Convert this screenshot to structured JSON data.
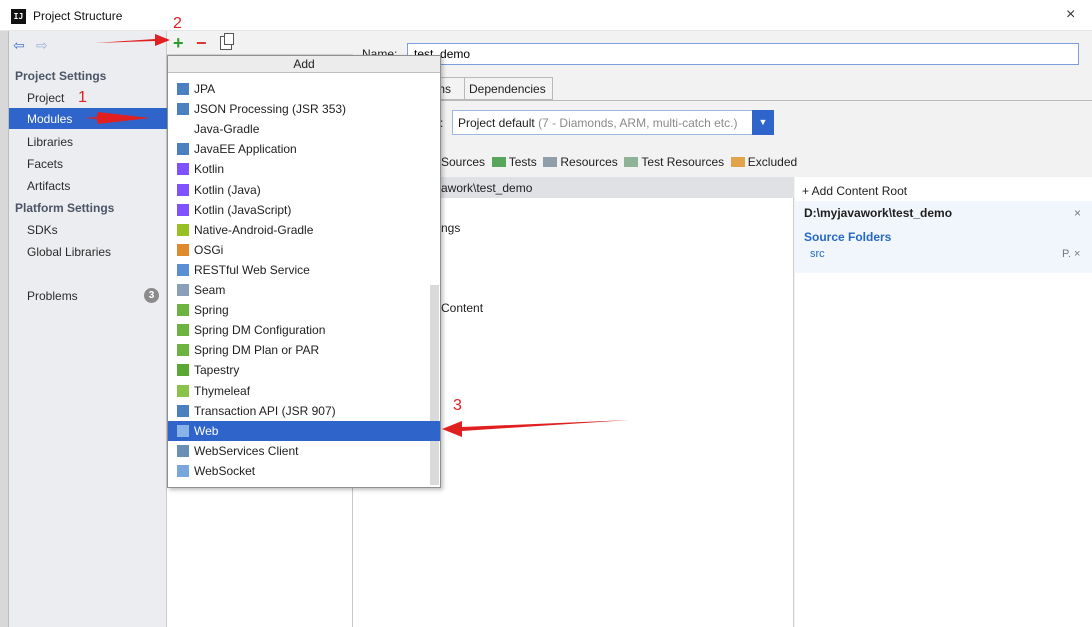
{
  "window": {
    "title": "Project Structure",
    "close": "×"
  },
  "nav": {
    "back": "⇦",
    "forward": "⇨"
  },
  "sidebar": {
    "project_settings": "Project Settings",
    "items": [
      "Project",
      "Modules",
      "Libraries",
      "Facets",
      "Artifacts"
    ],
    "platform_settings": "Platform Settings",
    "platform_items": [
      "SDKs",
      "Global Libraries"
    ],
    "problems": "Problems",
    "problems_count": "3"
  },
  "toolbar": {
    "add": "+",
    "remove": "−"
  },
  "popup": {
    "title": "Add",
    "items": [
      {
        "label": "JPA",
        "icon": "jpa-icon",
        "color": "#4a7fc0"
      },
      {
        "label": "JSON Processing (JSR 353)",
        "icon": "json-icon",
        "color": "#4a7fc0"
      },
      {
        "label": "Java-Gradle",
        "icon": "",
        "color": ""
      },
      {
        "label": "JavaEE Application",
        "icon": "javaee-icon",
        "color": "#4a7fc0"
      },
      {
        "label": "Kotlin",
        "icon": "kotlin-icon",
        "color": "#7f52ff"
      },
      {
        "label": "Kotlin (Java)",
        "icon": "kotlin-icon",
        "color": "#7f52ff"
      },
      {
        "label": "Kotlin (JavaScript)",
        "icon": "kotlin-icon",
        "color": "#7f52ff"
      },
      {
        "label": "Native-Android-Gradle",
        "icon": "android-icon",
        "color": "#97c024"
      },
      {
        "label": "OSGi",
        "icon": "osgi-icon",
        "color": "#e08a2e"
      },
      {
        "label": "RESTful Web Service",
        "icon": "rest-icon",
        "color": "#5b8fd4"
      },
      {
        "label": "Seam",
        "icon": "seam-icon",
        "color": "#8aa0b8"
      },
      {
        "label": "Spring",
        "icon": "spring-icon",
        "color": "#6db33f"
      },
      {
        "label": "Spring DM Configuration",
        "icon": "spring-dm-icon",
        "color": "#6db33f"
      },
      {
        "label": "Spring DM Plan or PAR",
        "icon": "spring-dm-icon",
        "color": "#6db33f"
      },
      {
        "label": "Tapestry",
        "icon": "tapestry-icon",
        "color": "#5aa832"
      },
      {
        "label": "Thymeleaf",
        "icon": "thymeleaf-icon",
        "color": "#8bc34a"
      },
      {
        "label": "Transaction API (JSR 907)",
        "icon": "transaction-icon",
        "color": "#4a7fc0"
      },
      {
        "label": "Web",
        "icon": "web-icon",
        "color": "#8ab4e8"
      },
      {
        "label": "WebServices Client",
        "icon": "ws-client-icon",
        "color": "#6a8fb5"
      },
      {
        "label": "WebSocket",
        "icon": "websocket-icon",
        "color": "#7aa7d9"
      }
    ],
    "selected_index": 17
  },
  "right": {
    "name_label": "Name:",
    "name_value": "test_demo",
    "tab_paths_partial": "ths",
    "tab_dependencies": "Dependencies",
    "lang_colon": ":",
    "lang_value": "Project default",
    "lang_hint": "(7 - Diamonds, ARM, multi-catch etc.)",
    "mark_sources": "Sources",
    "mark_tests": "Tests",
    "mark_resources": "Resources",
    "mark_test_resources": "Test Resources",
    "mark_excluded": "Excluded",
    "path_partial": "awork\\test_demo",
    "settings_partial": "ngs",
    "content_partial": "Content",
    "add_content_root": "+ Add Content Root",
    "root_path": "D:\\myjavawork\\test_demo",
    "source_folders": "Source Folders",
    "source_item": "src",
    "source_actions": "P. ×",
    "root_close": "×"
  },
  "annotations": {
    "one": "1",
    "two": "2",
    "three": "3"
  },
  "colors": {
    "selection": "#2f65ca",
    "annotation": "#e02020",
    "sources_folder": "#4a86c6",
    "tests_folder": "#58a55c",
    "resources_folder": "#8f9ea8",
    "excluded_folder": "#e3a34a"
  }
}
